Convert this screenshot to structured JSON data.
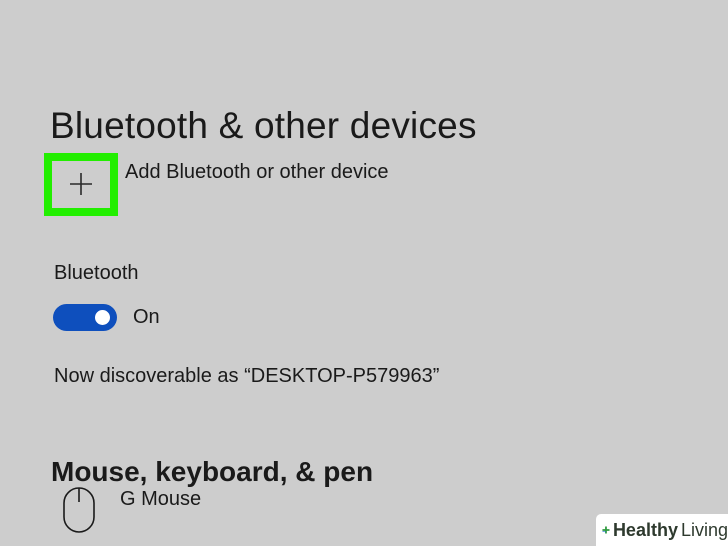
{
  "page": {
    "title": "Bluetooth & other devices"
  },
  "add_device": {
    "label": "Add Bluetooth or other device",
    "icon": "plus-icon",
    "highlight_color": "#22ee00"
  },
  "bluetooth": {
    "section_label": "Bluetooth",
    "toggle_state": "On",
    "toggle_on": true,
    "toggle_color": "#0e4fbd",
    "discoverable_text": "Now discoverable as “DESKTOP-P579963”"
  },
  "mouse_keyboard_pen": {
    "heading": "Mouse, keyboard, & pen",
    "devices": [
      {
        "name": "G Mouse",
        "icon": "mouse-icon"
      }
    ]
  },
  "watermark": {
    "brand_bold": "Healthy",
    "brand_light": "Living",
    "brand_color": "#2e9a3e"
  },
  "colors": {
    "background": "#cdcdcd",
    "text": "#1a1a1a"
  }
}
